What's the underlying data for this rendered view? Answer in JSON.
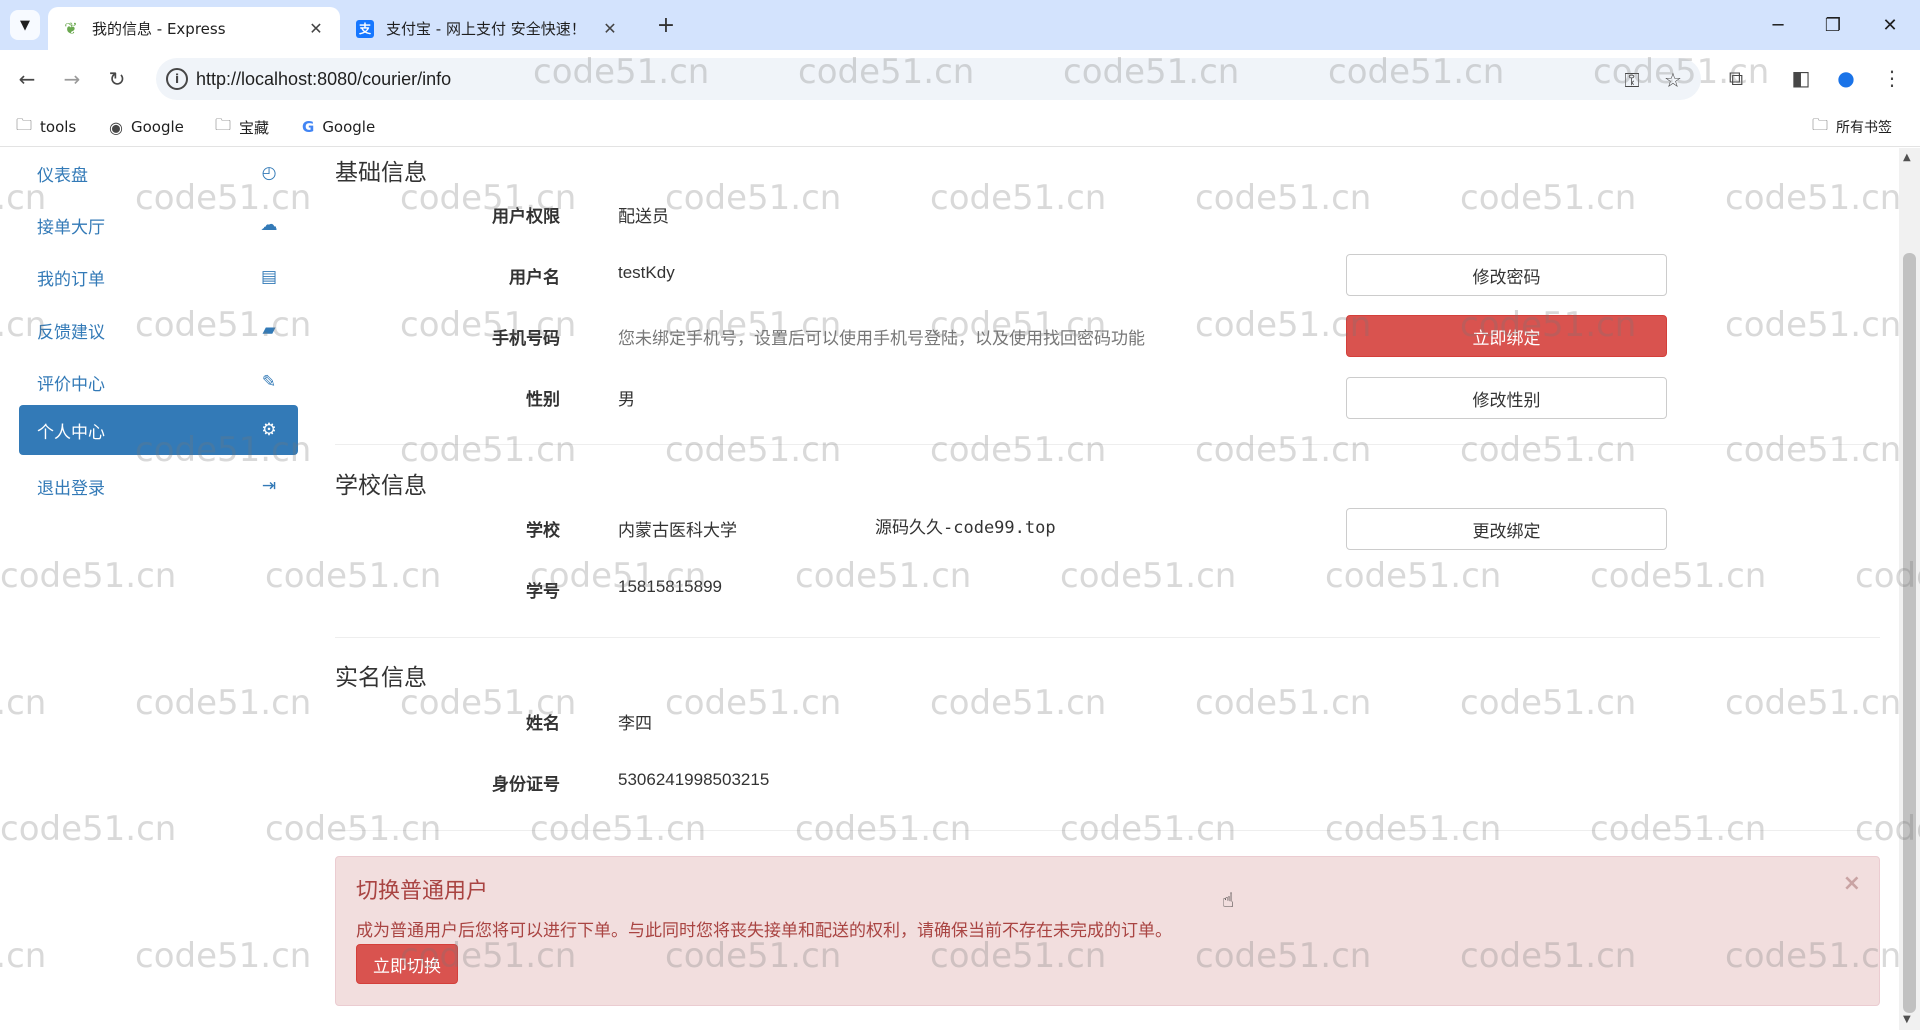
{
  "browser": {
    "tabs": [
      {
        "title": "我的信息 - Express",
        "active": true,
        "icon": "leaf-icon"
      },
      {
        "title": "支付宝 - 网上支付 安全快速！",
        "active": false,
        "icon": "alipay-icon"
      }
    ],
    "url": "http://localhost:8080/courier/info",
    "bookmarks": [
      {
        "label": "tools",
        "icon": "folder-icon"
      },
      {
        "label": "Google",
        "icon": "globe-icon"
      },
      {
        "label": "宝藏",
        "icon": "folder-icon"
      },
      {
        "label": "Google",
        "icon": "google-icon"
      }
    ],
    "all_bookmarks": "所有书签"
  },
  "sidebar": {
    "items": [
      {
        "label": "仪表盘",
        "icon": "dashboard-icon"
      },
      {
        "label": "接单大厅",
        "icon": "cloud-download-icon"
      },
      {
        "label": "我的订单",
        "icon": "list-icon"
      },
      {
        "label": "反馈建议",
        "icon": "comment-icon"
      },
      {
        "label": "评价中心",
        "icon": "edit-icon"
      },
      {
        "label": "个人中心",
        "icon": "gear-icon",
        "active": true
      },
      {
        "label": "退出登录",
        "icon": "logout-icon"
      }
    ]
  },
  "basic": {
    "title": "基础信息",
    "role_label": "用户权限",
    "role_value": "配送员",
    "username_label": "用户名",
    "username_value": "testKdy",
    "change_password": "修改密码",
    "phone_label": "手机号码",
    "phone_value": "您未绑定手机号，设置后可以使用手机号登陆，以及使用找回密码功能",
    "bind_now": "立即绑定",
    "gender_label": "性别",
    "gender_value": "男",
    "change_gender": "修改性别"
  },
  "school": {
    "title": "学校信息",
    "school_label": "学校",
    "school_value": "内蒙古医科大学",
    "note": "源码久久-code99.top",
    "change_binding": "更改绑定",
    "student_no_label": "学号",
    "student_no_value": "15815815899"
  },
  "realname": {
    "title": "实名信息",
    "name_label": "姓名",
    "name_value": "李四",
    "id_label": "身份证号",
    "id_value": "5306241998503215"
  },
  "alert": {
    "title": "切换普通用户",
    "text": "成为普通用户后您将可以进行下单。与此同时您将丧失接单和配送的权利，请确保当前不存在未完成的订单。",
    "button": "立即切换"
  },
  "watermark": "code51.cn",
  "colors": {
    "primary": "#337ab7",
    "danger": "#d9534f",
    "alert_bg": "#f2dede",
    "alert_text": "#a94442",
    "tabbar": "#d3e3fd"
  }
}
